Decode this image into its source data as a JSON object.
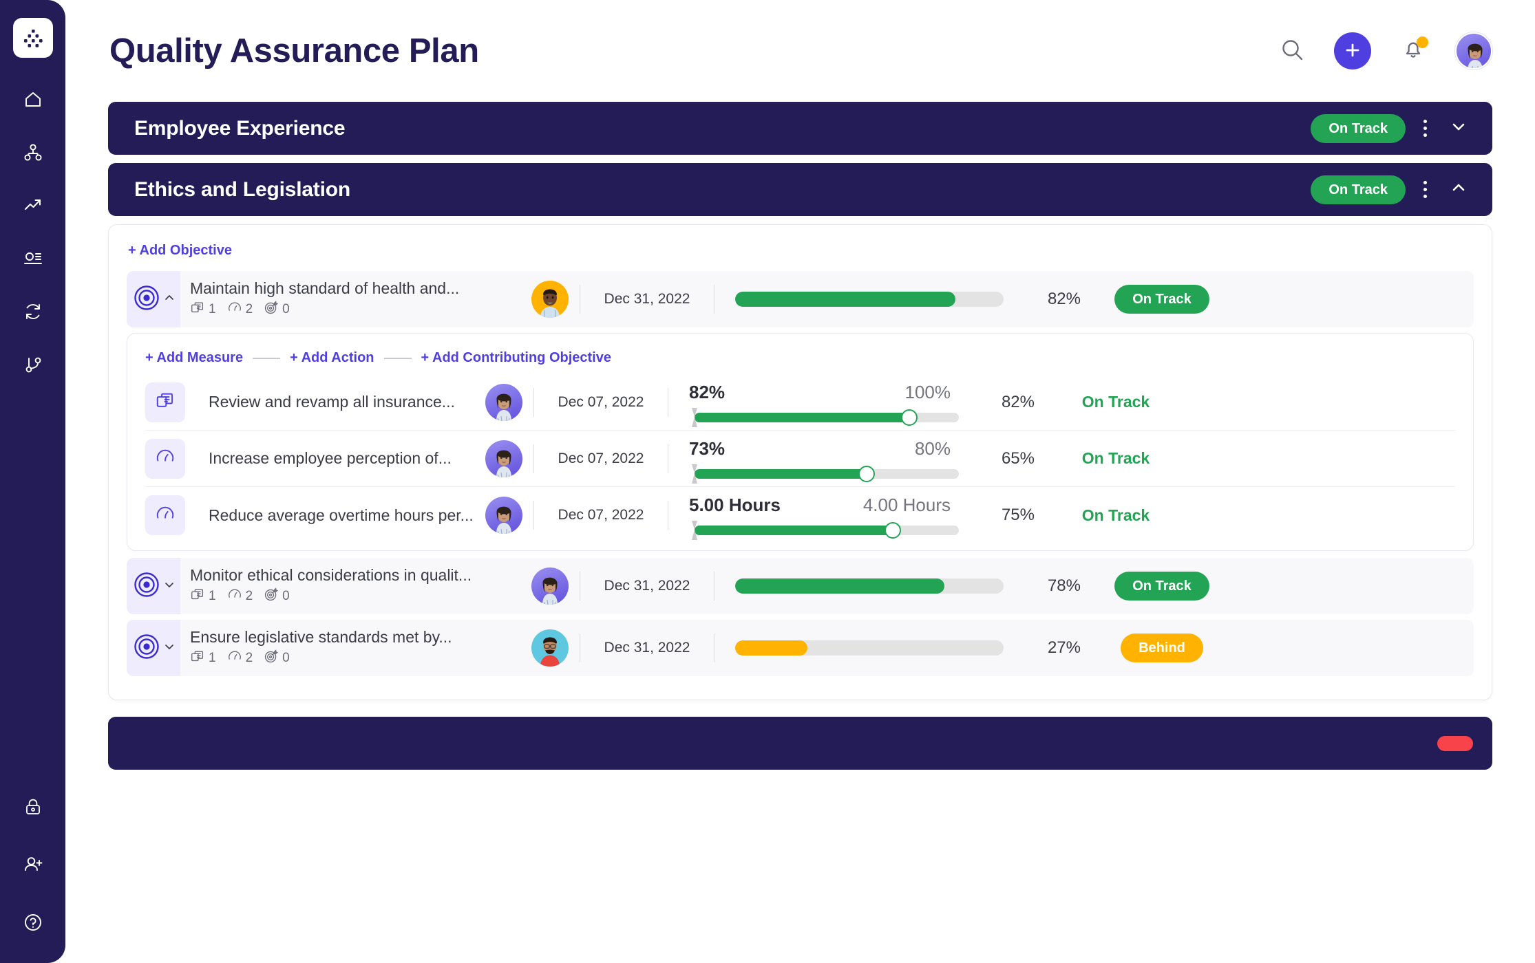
{
  "header": {
    "title": "Quality Assurance Plan",
    "icons": {
      "search": "search-icon",
      "add": "plus-icon",
      "notifications": "bell-icon",
      "avatar": "user-avatar"
    }
  },
  "sidebar": {
    "logo": "app-logo-dots",
    "top_items": [
      {
        "icon": "home-icon",
        "name": "home"
      },
      {
        "icon": "network-icon",
        "name": "organisation"
      },
      {
        "icon": "trending-up-icon",
        "name": "performance"
      },
      {
        "icon": "list-detail-icon",
        "name": "reports"
      },
      {
        "icon": "refresh-cycle-icon",
        "name": "cycles"
      },
      {
        "icon": "branch-icon",
        "name": "workflows"
      }
    ],
    "bottom_items": [
      {
        "icon": "lock-icon",
        "name": "security"
      },
      {
        "icon": "user-add-icon",
        "name": "invite-user"
      },
      {
        "icon": "help-circle-icon",
        "name": "help"
      }
    ]
  },
  "sections": [
    {
      "title": "Employee Experience",
      "status": "On Track",
      "status_color": "#23a455",
      "expanded": false,
      "chevron": "chevron-down-icon"
    },
    {
      "title": "Ethics and Legislation",
      "status": "On Track",
      "status_color": "#23a455",
      "expanded": true,
      "chevron": "chevron-up-icon"
    }
  ],
  "panel": {
    "add_objective_label": "+ Add Objective",
    "add_links": [
      "+ Add Measure",
      "+ Add Action",
      "+ Add Contributing Objective"
    ]
  },
  "objectives": [
    {
      "name": "Maintain high standard of health and...",
      "expanded": true,
      "chevron": "chevron-up-icon",
      "icon": "target-icon",
      "counts": {
        "documents": "1",
        "measures": "2",
        "objectives": "0"
      },
      "owner_avatar": "avatar-man-yellow",
      "due_date": "Dec 31, 2022",
      "progress": 82,
      "progress_label": "82%",
      "progress_color": "#23a455",
      "status": "On Track",
      "status_style": "green"
    },
    {
      "name": "Monitor ethical considerations in qualit...",
      "expanded": false,
      "chevron": "chevron-down-icon",
      "icon": "target-icon",
      "counts": {
        "documents": "1",
        "measures": "2",
        "objectives": "0"
      },
      "owner_avatar": "avatar-woman-purple",
      "due_date": "Dec 31, 2022",
      "progress": 78,
      "progress_label": "78%",
      "progress_color": "#23a455",
      "status": "On Track",
      "status_style": "green"
    },
    {
      "name": "Ensure legislative standards met by...",
      "expanded": false,
      "chevron": "chevron-down-icon",
      "icon": "target-icon",
      "counts": {
        "documents": "1",
        "measures": "2",
        "objectives": "0"
      },
      "owner_avatar": "avatar-man-red",
      "due_date": "Dec 31, 2022",
      "progress": 27,
      "progress_label": "27%",
      "progress_color": "#ffb300",
      "status": "Behind",
      "status_style": "amber"
    }
  ],
  "measures": [
    {
      "name": "Review and revamp all insurance...",
      "icon": "document-icon",
      "owner_avatar": "avatar-woman-purple",
      "due_date": "Dec 07, 2022",
      "current_value": "82%",
      "target_value": "100%",
      "fill_percent": 82,
      "progress_label": "82%",
      "status": "On Track",
      "status_color": "#23a455"
    },
    {
      "name": "Increase employee perception of...",
      "icon": "gauge-icon",
      "owner_avatar": "avatar-woman-purple",
      "due_date": "Dec 07, 2022",
      "current_value": "73%",
      "target_value": "80%",
      "fill_percent": 65,
      "progress_label": "65%",
      "status": "On Track",
      "status_color": "#23a455"
    },
    {
      "name": "Reduce average overtime hours per...",
      "icon": "gauge-icon",
      "owner_avatar": "avatar-woman-purple",
      "due_date": "Dec 07, 2022",
      "current_value": "5.00 Hours",
      "target_value": "4.00 Hours",
      "fill_percent": 75,
      "progress_label": "75%",
      "status": "On Track",
      "status_color": "#23a455"
    }
  ],
  "next_section": {
    "status_color": "#f9434b"
  }
}
